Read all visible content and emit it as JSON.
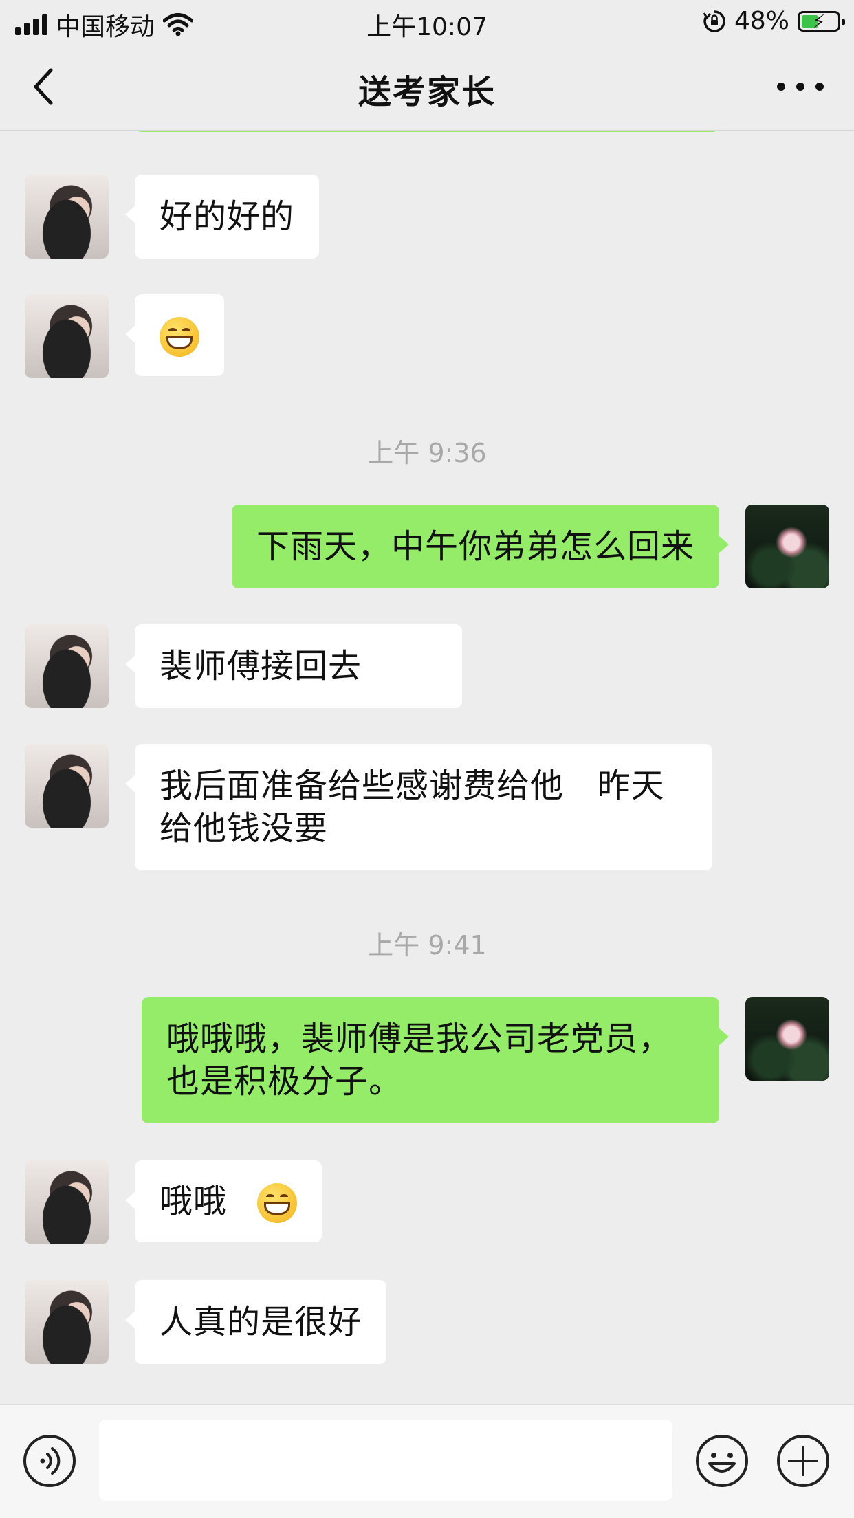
{
  "status_bar": {
    "carrier": "中国移动",
    "time": "上午10:07",
    "battery_text": "48%",
    "battery_level": 0.48,
    "icons": [
      "signal-icon",
      "wifi-icon",
      "orientation-lock-icon",
      "battery-charging-icon"
    ]
  },
  "nav": {
    "title": "送考家长",
    "back_icon": "chevron-left-icon",
    "more_icon": "more-dots-icon"
  },
  "timestamps": [
    "上午 9:36",
    "上午 9:41"
  ],
  "messages": [
    {
      "side": "left",
      "text": "好的好的"
    },
    {
      "side": "left",
      "emoji": "grinning-emoji"
    },
    {
      "side": "right",
      "text": "下雨天，中午你弟弟怎么回来"
    },
    {
      "side": "left",
      "text": "裴师傅接回去"
    },
    {
      "side": "left",
      "line1": "我后面准备给些感谢费给他   昨天",
      "line2": "给他钱没要"
    },
    {
      "side": "right",
      "line1": "哦哦哦，裴师傅是我公司老党员，",
      "line2": "也是积极分子。"
    },
    {
      "side": "left",
      "text": "哦哦",
      "emoji": "grinning-emoji"
    },
    {
      "side": "left",
      "text": "人真的是很好"
    }
  ],
  "input_bar": {
    "value": "",
    "icons": [
      "voice-icon",
      "emoji-icon",
      "plus-icon"
    ]
  },
  "colors": {
    "background": "#ededed",
    "outgoing_bubble": "#95ec69",
    "incoming_bubble": "#ffffff",
    "timestamp_text": "#a8a8a8"
  }
}
